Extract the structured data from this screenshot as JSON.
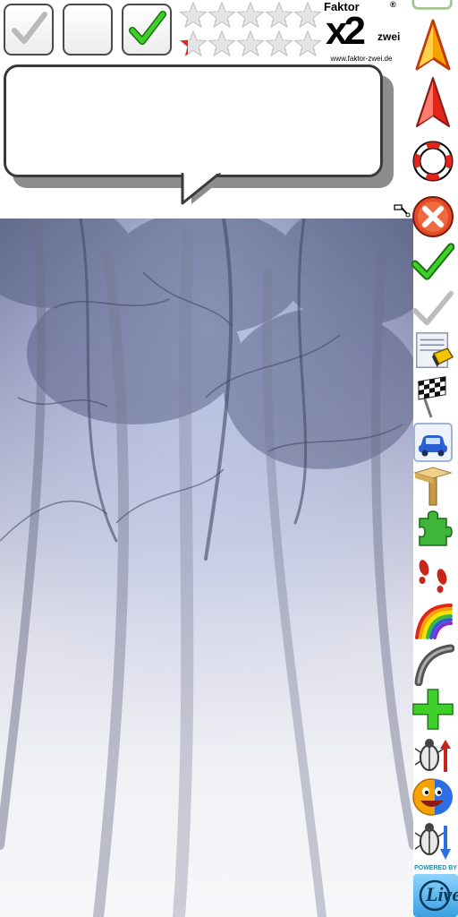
{
  "checkboxes": [
    {
      "state": "disabled-checked"
    },
    {
      "state": "unchecked"
    },
    {
      "state": "checked"
    }
  ],
  "ratings": [
    {
      "value": 0,
      "max": 5
    },
    {
      "value": 0.1,
      "max": 5
    }
  ],
  "logo": {
    "word_top": "Faktor",
    "mark": "x2",
    "word_side": "zwei",
    "registered": "®",
    "url": "www.faktor-zwei.de"
  },
  "bubble": {
    "text": ""
  },
  "toolbar": {
    "items": [
      {
        "icon": "text-field-icon"
      },
      {
        "icon": "navigation-arrow-orange-icon"
      },
      {
        "icon": "navigation-arrow-red-icon"
      },
      {
        "icon": "lifebuoy-icon"
      },
      {
        "icon": "close-icon"
      },
      {
        "icon": "checkmark-green-icon"
      },
      {
        "icon": "checkmark-gray-icon"
      },
      {
        "icon": "notebook-eraser-icon"
      },
      {
        "icon": "checkered-flag-icon"
      },
      {
        "icon": "car-icon"
      },
      {
        "icon": "signpost-icon"
      },
      {
        "icon": "puzzle-piece-icon"
      },
      {
        "icon": "footprints-icon"
      },
      {
        "icon": "rainbow-icon"
      },
      {
        "icon": "gray-road-icon"
      },
      {
        "icon": "plus-icon"
      },
      {
        "icon": "beetle-up-icon"
      },
      {
        "icon": "smiley-icon"
      },
      {
        "icon": "beetle-down-icon"
      }
    ]
  },
  "powered_by": {
    "label": "POWERED BY",
    "brand": "Live"
  },
  "colors": {
    "accent_green": "#2fb21f",
    "accent_red": "#e2251b",
    "accent_orange": "#f5a300"
  }
}
